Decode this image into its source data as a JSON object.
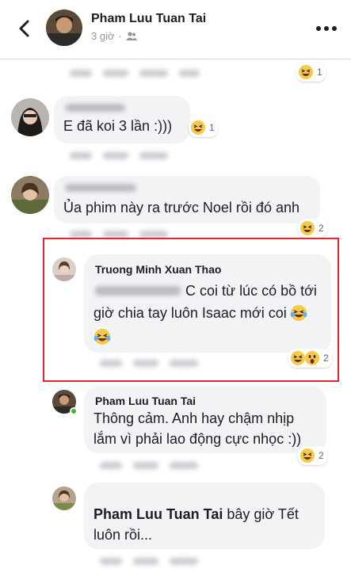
{
  "header": {
    "title": "Pham Luu Tuan Tai",
    "time": "3 giờ",
    "separator": "·"
  },
  "comments": [
    {
      "text": "E đã koi 3 lần :)))",
      "reaction_count": "1"
    },
    {
      "text": "Ủa phim này ra trước Noel rồi đó anh",
      "reaction_count": "2"
    }
  ],
  "highlighted_reply": {
    "author": "Truong Minh Xuan Thao",
    "text_line1": "C coi từ lúc có bồ tới",
    "text_line2": "giờ chia tay luôn Isaac mới coi",
    "reaction_count": "2"
  },
  "reply2": {
    "author": "Pham Luu Tuan Tai",
    "text_line1": "Thông cảm. Anh hay chậm nhịp",
    "text_line2": "lắm vì phải lao động cực nhọc :))",
    "reaction_count": "2"
  },
  "reply3": {
    "mention": "Pham Luu Tuan Tai",
    "text_line1_rest": " bây giờ Tết",
    "text_line2": "luôn rồi..."
  },
  "top_reaction_count": "1",
  "colors": {
    "highlight": "#e2262b",
    "bubble": "#f2f3f5",
    "muted": "#90949c"
  }
}
